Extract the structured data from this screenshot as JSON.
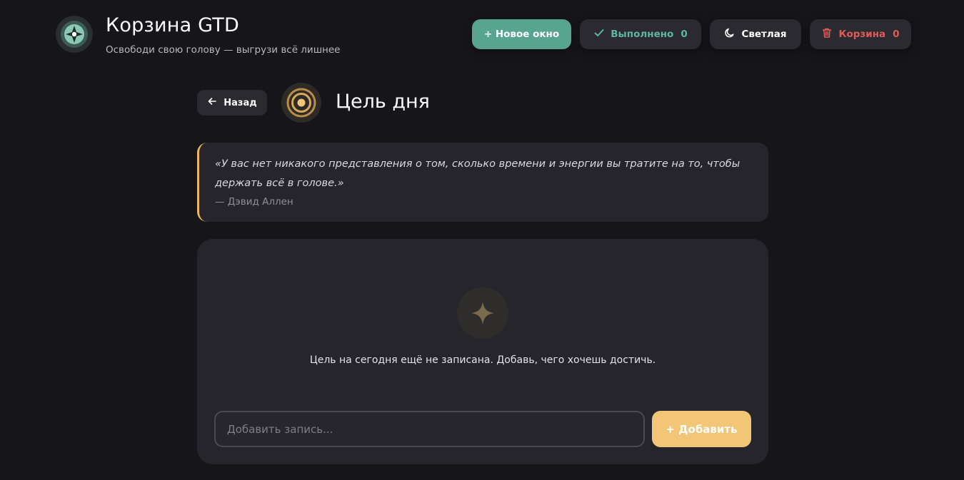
{
  "header": {
    "title": "Корзина GTD",
    "subtitle": "Освободи свою голову — выгрузи всё лишнее",
    "new_window_label": "+ Новое окно",
    "done_label": "Выполнено",
    "done_count": "0",
    "theme_label": "Светлая",
    "trash_label": "Корзина",
    "trash_count": "0"
  },
  "section": {
    "back_label": "Назад",
    "title": "Цель дня"
  },
  "quote": {
    "text": "«У вас нет никакого представления о том, сколько времени и энергии вы тратите на то, чтобы держать всё в голове.»",
    "author": "— Дэвид Аллен"
  },
  "main": {
    "empty_text": "Цель на сегодня ещё не записана. Добавь, чего хочешь достичь.",
    "input_placeholder": "Добавить запись...",
    "add_label": "+ Добавить"
  },
  "colors": {
    "accent_green": "#58a58f",
    "accent_gold": "#f3c576",
    "danger_red": "#e05a5a",
    "background": "#161519",
    "card": "#25252b"
  },
  "icons": {
    "brand": "compass-icon",
    "done": "check-icon",
    "theme": "moon-icon",
    "trash": "trash-icon",
    "back": "arrow-left-icon",
    "section": "target-icon",
    "empty": "sparkle-icon"
  }
}
